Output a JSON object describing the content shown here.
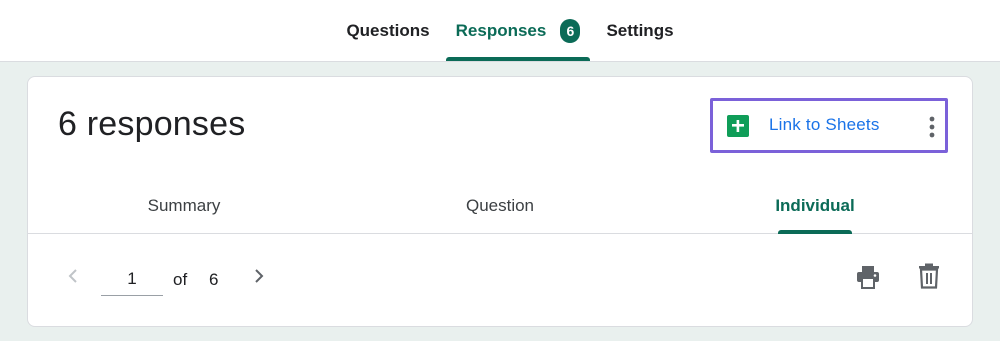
{
  "top_tabs": {
    "questions_label": "Questions",
    "responses_label": "Responses",
    "responses_count": "6",
    "settings_label": "Settings"
  },
  "card": {
    "title": "6 responses",
    "link_to_sheets_label": "Link to Sheets",
    "more_options_icon": "more-vert-icon",
    "sheets_icon": "google-sheets-icon"
  },
  "sub_tabs": {
    "summary_label": "Summary",
    "question_label": "Question",
    "individual_label": "Individual",
    "active": "Individual"
  },
  "pager": {
    "current_page": "1",
    "of_label": "of",
    "total_pages": "6"
  },
  "actions": {
    "print_icon": "print-icon",
    "delete_icon": "trash-icon"
  },
  "colors": {
    "accent": "#0b6b57",
    "link": "#1a73e8",
    "highlight_border": "#7b61d9",
    "page_background": "#e9f0ee"
  }
}
